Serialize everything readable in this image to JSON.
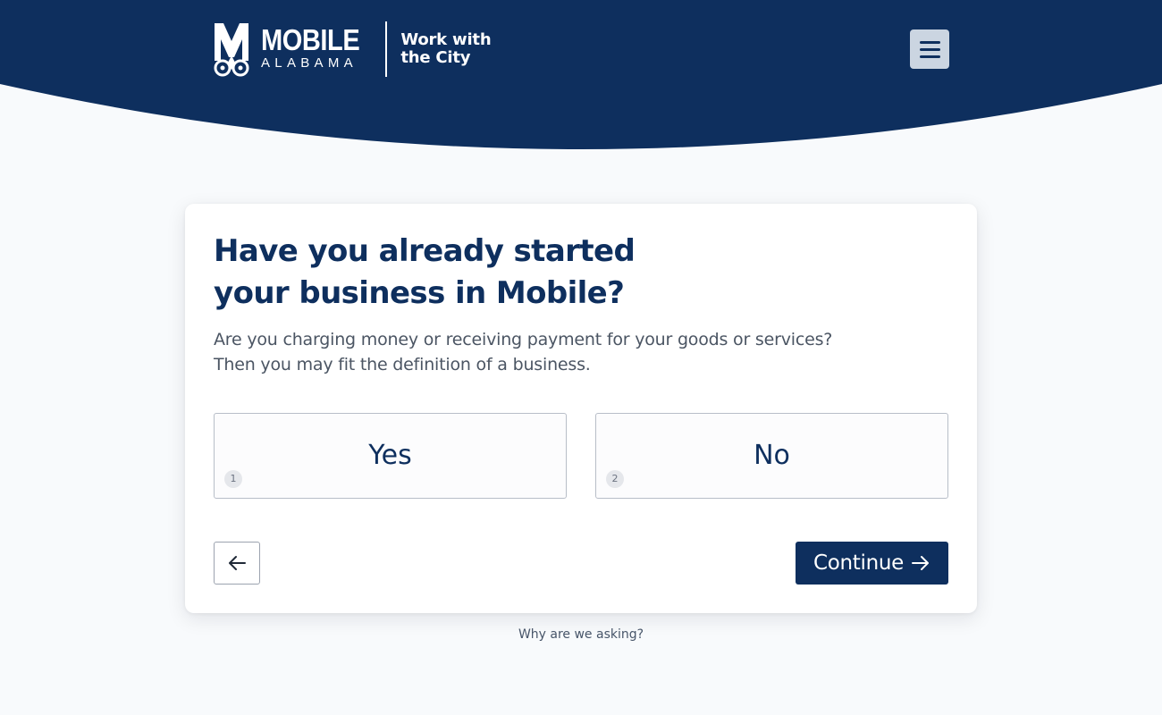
{
  "header": {
    "logo_word": "MOBILE",
    "logo_state": "ALABAMA",
    "tagline_line1": "Work with",
    "tagline_line2": "the City",
    "menu_icon": "hamburger-menu-icon",
    "bg_color": "#0e2f5e"
  },
  "question": {
    "title_line1": "Have you already started",
    "title_line2": "your business in Mobile?",
    "help_line1": "Are you charging money or receiving payment for your goods or services?",
    "help_line2": "Then you may fit the definition of a business."
  },
  "choices": [
    {
      "label": "Yes",
      "key": "1"
    },
    {
      "label": "No",
      "key": "2"
    }
  ],
  "nav": {
    "back_icon": "arrow-left-icon",
    "continue_label": "Continue",
    "continue_icon": "arrow-right-icon"
  },
  "footer": {
    "why_link": "Why are we asking?"
  },
  "colors": {
    "brand_navy": "#0e2f5e",
    "page_bg": "#f8fafc",
    "menu_button_bg": "#cbd5e1"
  }
}
